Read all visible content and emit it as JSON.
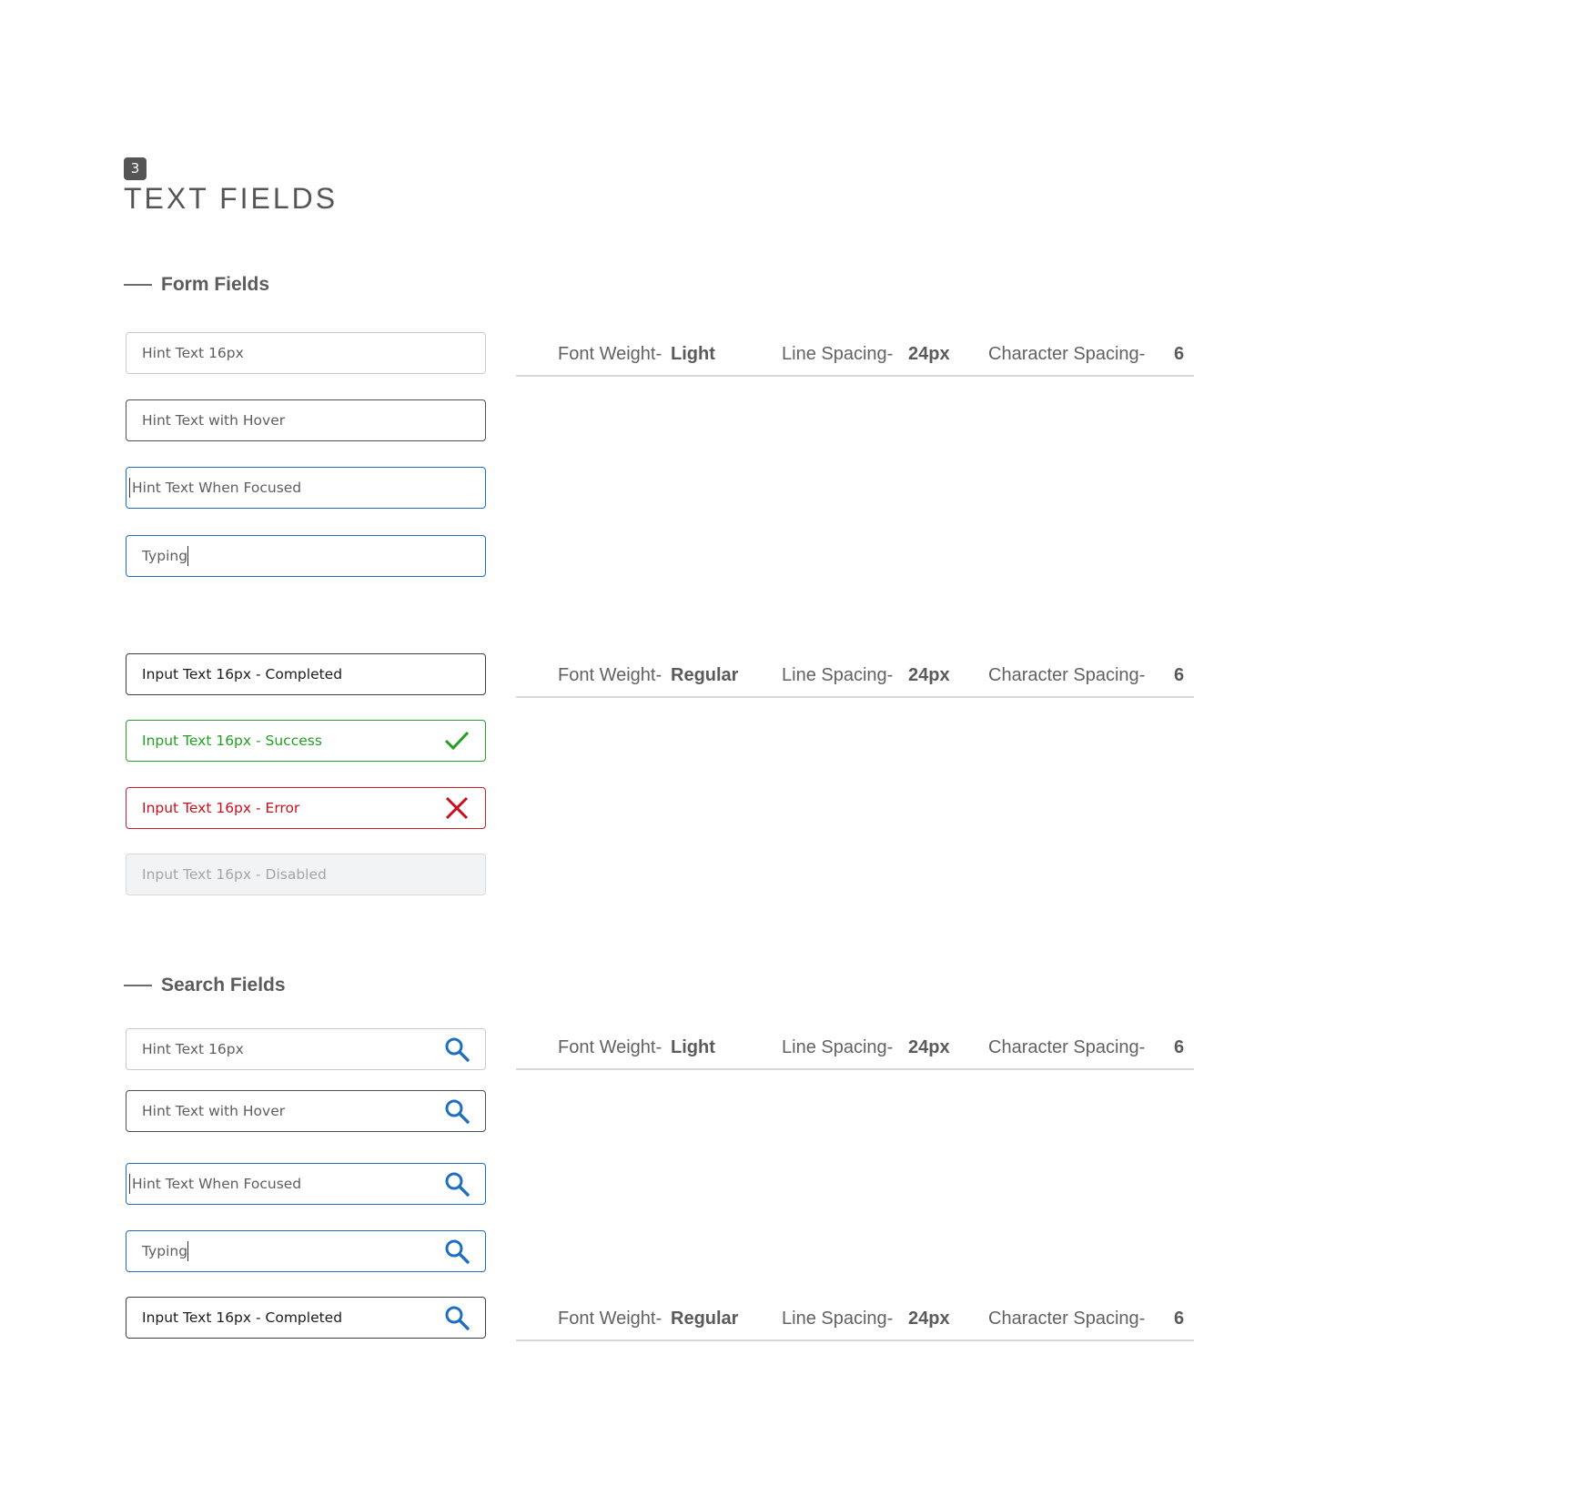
{
  "header": {
    "badge": "3",
    "title": "TEXT FIELDS"
  },
  "sections": {
    "form": "Form Fields",
    "search": "Search Fields"
  },
  "form_fields": {
    "hint": "Hint Text 16px",
    "hover": "Hint Text with Hover",
    "focused": "Hint Text When Focused",
    "typing": "Typing",
    "completed": "Input Text 16px - Completed",
    "success": "Input Text 16px - Success",
    "error": "Input Text 16px - Error",
    "disabled": "Input Text 16px - Disabled"
  },
  "search_fields": {
    "hint": "Hint Text 16px",
    "hover": "Hint Text with Hover",
    "focused": "Hint Text When Focused",
    "typing": "Typing",
    "completed": "Input Text 16px - Completed"
  },
  "specs": {
    "font_weight_label": "Font Weight-",
    "line_spacing_label": "Line Spacing-",
    "char_spacing_label": "Character Spacing-",
    "light": "Light",
    "regular": "Regular",
    "line_spacing_value": "24px",
    "char_spacing_value": "6"
  },
  "colors": {
    "focus": "#1e6fc1",
    "success": "#22a022",
    "error": "#c8111e",
    "search_icon": "#1e6fc1"
  }
}
